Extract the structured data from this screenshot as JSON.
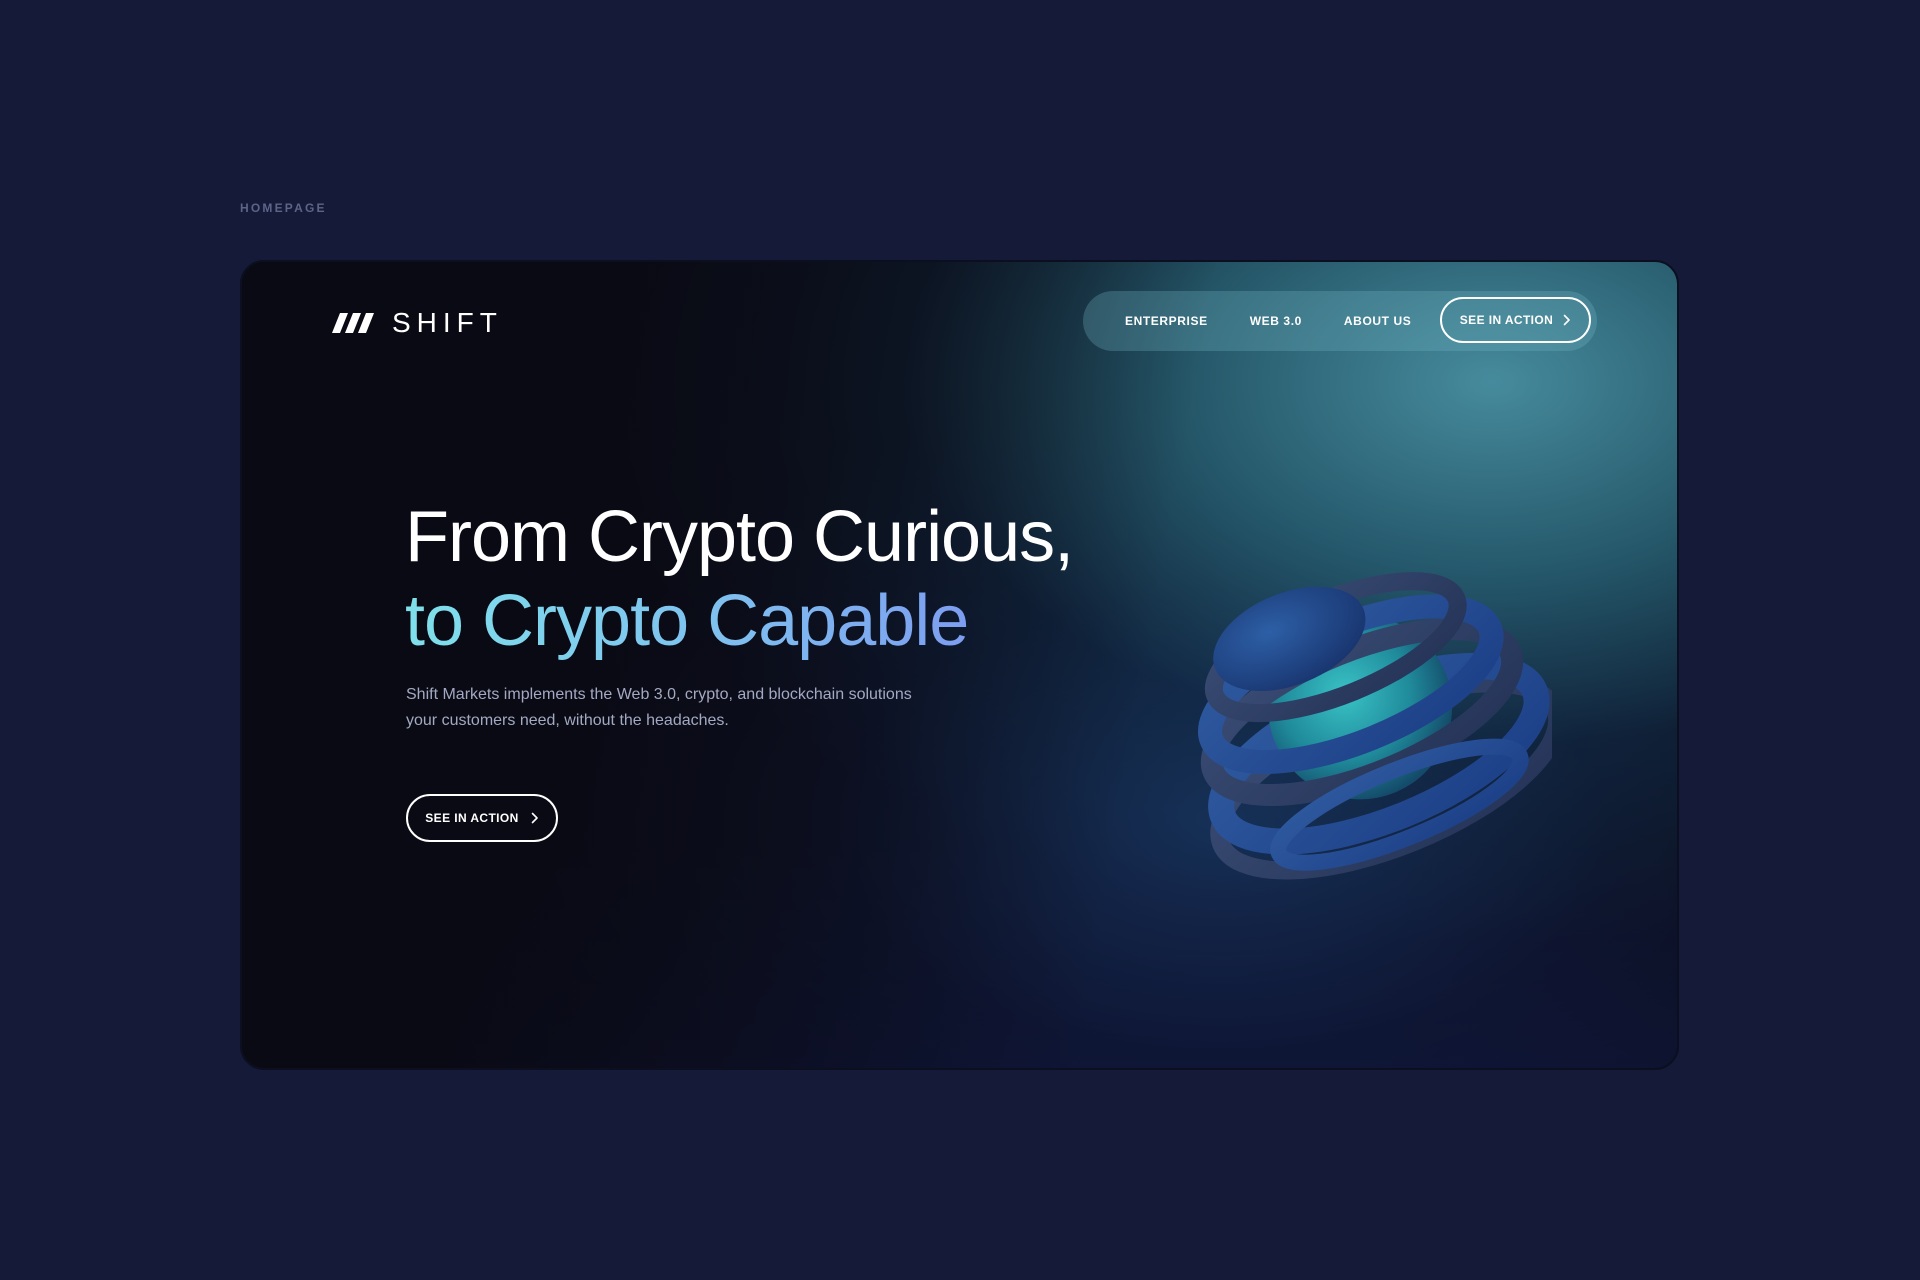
{
  "page_label": "HOMEPAGE",
  "brand": {
    "name": "SHIFT",
    "logo_icon": "shift-slashes-logo"
  },
  "nav": {
    "items": [
      {
        "label": "ENTERPRISE"
      },
      {
        "label": "WEB 3.0"
      },
      {
        "label": "ABOUT US"
      }
    ],
    "cta_label": "SEE IN ACTION"
  },
  "hero": {
    "headline_line1": "From Crypto Curious,",
    "headline_line2": "to Crypto Capable",
    "subtext_line1": "Shift Markets implements the Web 3.0, crypto, and blockchain solutions",
    "subtext_line2": "your customers need, without the headaches.",
    "cta_label": "SEE IN ACTION",
    "visual": "3d-ringed-sphere"
  },
  "colors": {
    "page_bg": "#141a38",
    "frame_bg": "#0b0c16",
    "accent_teal": "#4992a4",
    "gradient_start": "#7fe0ea",
    "gradient_end": "#7c8ff0",
    "text_muted": "#a3a9c2"
  }
}
